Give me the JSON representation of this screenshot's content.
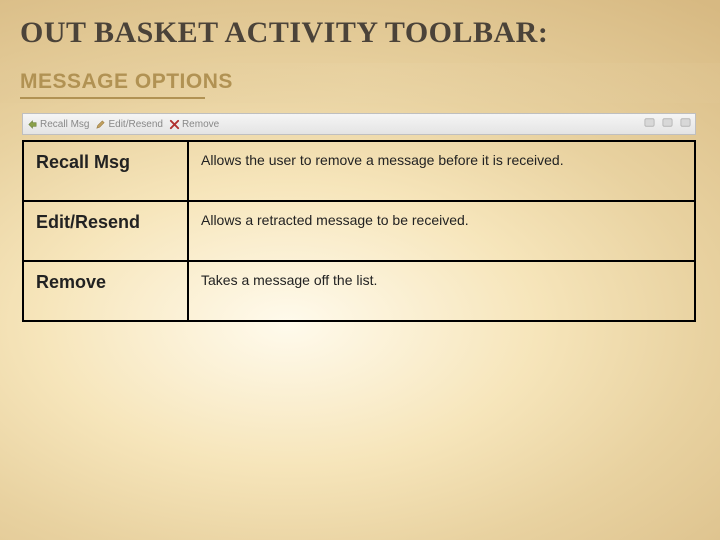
{
  "title": "OUT BASKET ACTIVITY TOOLBAR:",
  "subtitle": "MESSAGE OPTIONS",
  "toolbar": {
    "recall_label": "Recall Msg",
    "edit_label": "Edit/Resend",
    "remove_label": "Remove"
  },
  "rows": [
    {
      "name": "Recall Msg",
      "desc": "Allows the user to remove a message before it is received."
    },
    {
      "name": "Edit/Resend",
      "desc": "Allows a retracted message to be received."
    },
    {
      "name": "Remove",
      "desc": "Takes a message off the list."
    }
  ],
  "colors": {
    "accent": "#b19253"
  }
}
